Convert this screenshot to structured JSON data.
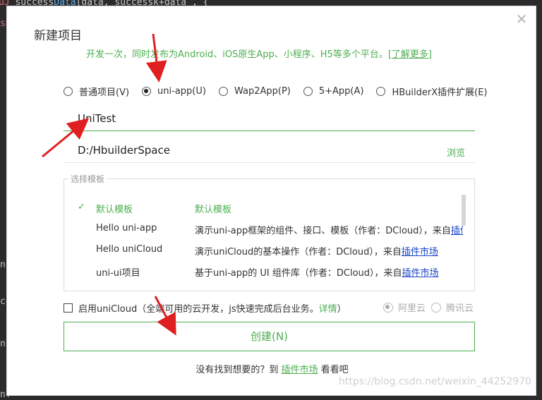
{
  "background_code": {
    "top_line_start": "u",
    "top_line_keyword": "J",
    "top_line_mid": " ",
    "top_line_text": "success",
    "top_line_fn": "Data",
    "top_line_rest": "(data,  successk+data  ,  {",
    "left_fragments": [
      "sN",
      "nn",
      "ce",
      "nn",
      "nf"
    ]
  },
  "dialog": {
    "title": "新建项目",
    "close_icon": "close-icon",
    "subtitle": "开发一次，同时发布为Android、iOS原生App、小程序、H5等多个平台。",
    "learn_more": "[了解更多]",
    "project_types": [
      {
        "label": "普通项目(V)",
        "checked": false
      },
      {
        "label": "uni-app(U)",
        "checked": true
      },
      {
        "label": "Wap2App(P)",
        "checked": false
      },
      {
        "label": "5+App(A)",
        "checked": false
      },
      {
        "label": "HBuilderX插件扩展(E)",
        "checked": false
      }
    ],
    "project_name": "UniTest",
    "project_path": "D:/HbuilderSpace",
    "browse_label": "浏览",
    "template_legend": "选择模板",
    "templates": [
      {
        "name": "默认模板",
        "desc": "默认模板",
        "link": "",
        "selected": true,
        "check": "✓"
      },
      {
        "name": "Hello uni-app",
        "desc": "演示uni-app框架的组件、接口、模板（作者：DCloud），来自",
        "link": "插件市场",
        "selected": false
      },
      {
        "name": "Hello uniCloud",
        "desc": "演示uniCloud的基本操作（作者：DCloud），来自",
        "link": "插件市场",
        "selected": false
      },
      {
        "name": "uni-ui项目",
        "desc": "基于uni-app的 UI 组件库（作者：DCloud），来自",
        "link": "插件市场",
        "selected": false
      }
    ],
    "unicloud": {
      "label": "启用uniCloud（全端可用的云开发，js快速完成后台业务。",
      "detail_link": "详情",
      "suffix": "）",
      "providers": [
        {
          "label": "阿里云",
          "checked": true
        },
        {
          "label": "腾讯云",
          "checked": false
        }
      ]
    },
    "create_button": "创建(N)",
    "footer_prefix": "没有找到想要的？到 ",
    "footer_link": "插件市场",
    "footer_suffix": " 看看吧"
  },
  "watermark": "https://blog.csdn.net/weixin_44252970",
  "colors": {
    "accent": "#4caf50",
    "annotation_arrow": "#e02020",
    "link_blue": "#1a45c8"
  }
}
